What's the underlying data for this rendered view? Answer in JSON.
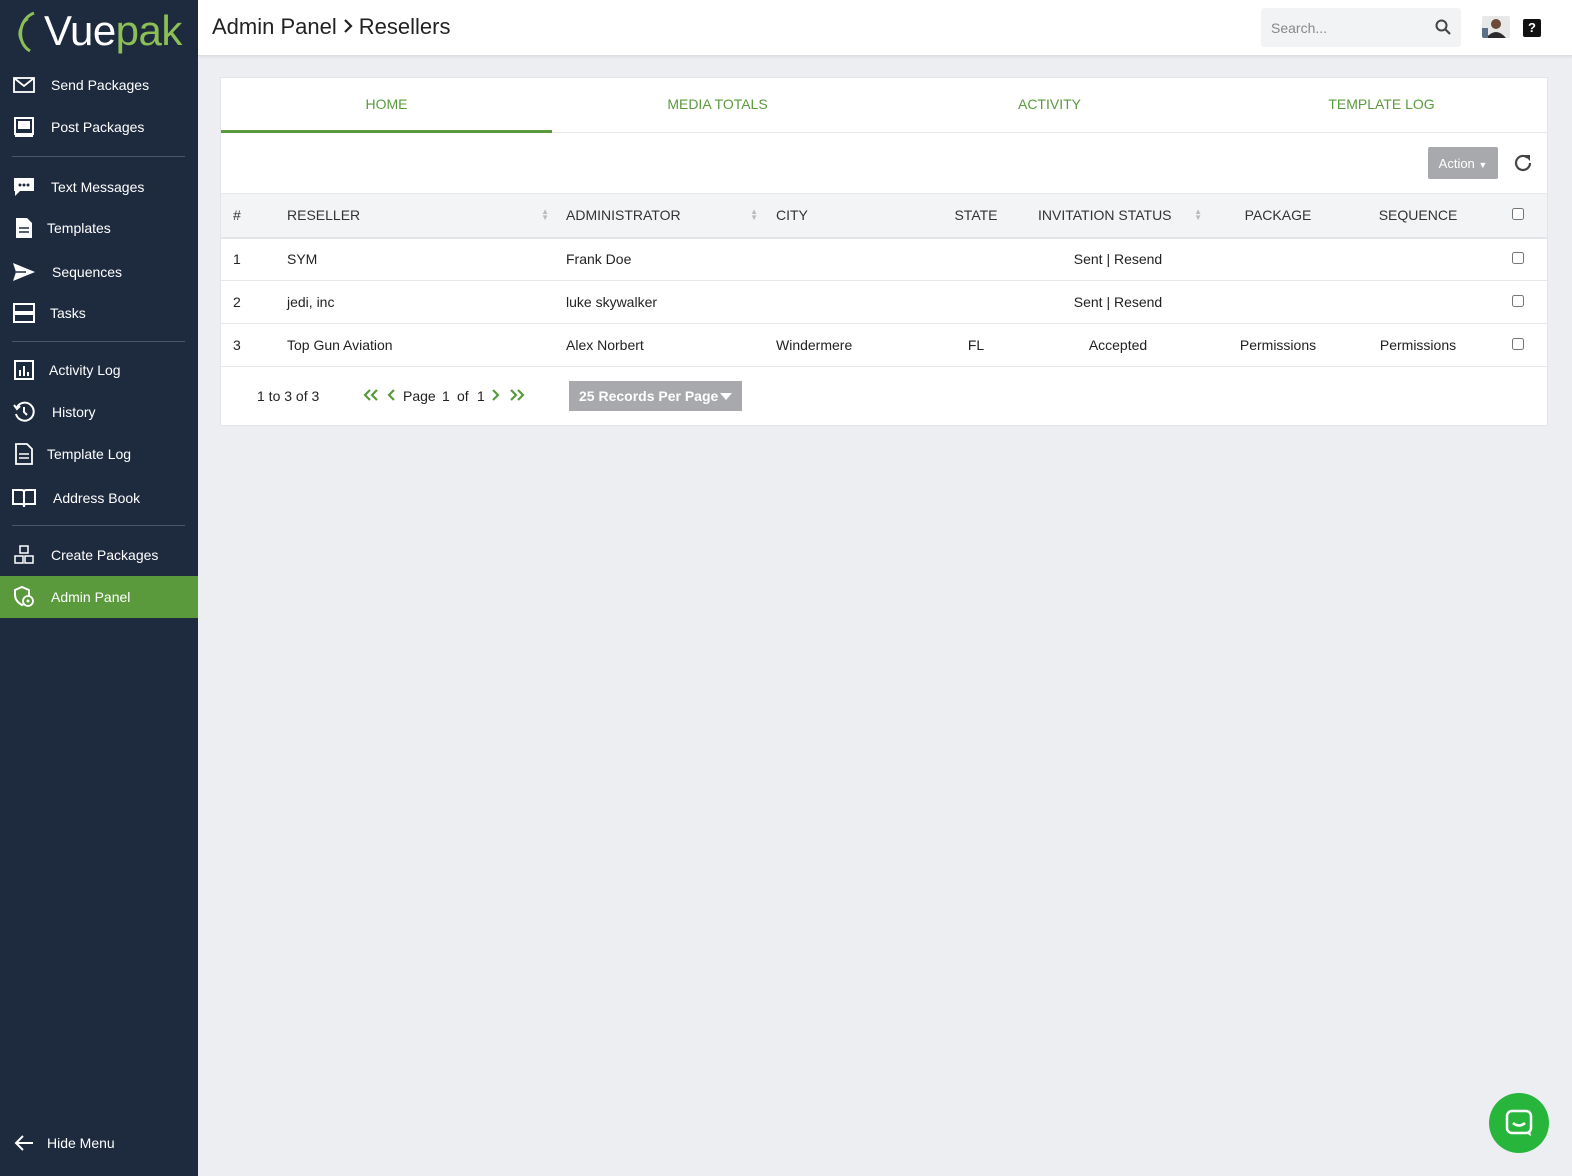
{
  "brand": {
    "vue": "Vue",
    "pak": "pak"
  },
  "sidebar": {
    "items": [
      {
        "label": "Send Packages",
        "icon": "envelope-icon"
      },
      {
        "label": "Post Packages",
        "icon": "monitor-icon"
      },
      {
        "label": "Text Messages",
        "icon": "chat-bubble-icon"
      },
      {
        "label": "Templates",
        "icon": "document-icon"
      },
      {
        "label": "Sequences",
        "icon": "paper-plane-icon"
      },
      {
        "label": "Tasks",
        "icon": "tasks-icon"
      },
      {
        "label": "Activity Log",
        "icon": "bar-chart-icon"
      },
      {
        "label": "History",
        "icon": "history-icon"
      },
      {
        "label": "Template Log",
        "icon": "document-icon"
      },
      {
        "label": "Address Book",
        "icon": "book-icon"
      },
      {
        "label": "Create Packages",
        "icon": "boxes-icon"
      },
      {
        "label": "Admin Panel",
        "icon": "admin-icon"
      }
    ],
    "hide_menu": "Hide Menu"
  },
  "header": {
    "crumb1": "Admin Panel",
    "crumb2": "Resellers",
    "search_placeholder": "Search...",
    "help": "?"
  },
  "tabs": [
    "HOME",
    "MEDIA TOTALS",
    "ACTIVITY",
    "TEMPLATE LOG"
  ],
  "toolbar": {
    "action_label": "Action"
  },
  "table": {
    "headers": [
      "#",
      "RESELLER",
      "ADMINISTRATOR",
      "CITY",
      "STATE",
      "INVITATION STATUS",
      "PACKAGE",
      "SEQUENCE"
    ],
    "rows": [
      {
        "num": "1",
        "reseller": "SYM",
        "admin": "Frank Doe",
        "city": "",
        "state": "",
        "status": "Sent | Resend",
        "package": "",
        "sequence": ""
      },
      {
        "num": "2",
        "reseller": "jedi, inc",
        "admin": "luke skywalker",
        "city": "",
        "state": "",
        "status": "Sent | Resend",
        "package": "",
        "sequence": ""
      },
      {
        "num": "3",
        "reseller": "Top Gun Aviation",
        "admin": "Alex Norbert",
        "city": "Windermere",
        "state": "FL",
        "status": "Accepted",
        "package": "Permissions",
        "sequence": "Permissions"
      }
    ]
  },
  "pager": {
    "range": "1 to 3 of 3",
    "page_word": "Page",
    "page": "1",
    "of_word": "of",
    "total": "1",
    "per_page": "25 Records Per Page"
  },
  "colors": {
    "sidebar": "#1e2a3e",
    "accent": "#5a9a3d",
    "chat": "#28b53c"
  }
}
